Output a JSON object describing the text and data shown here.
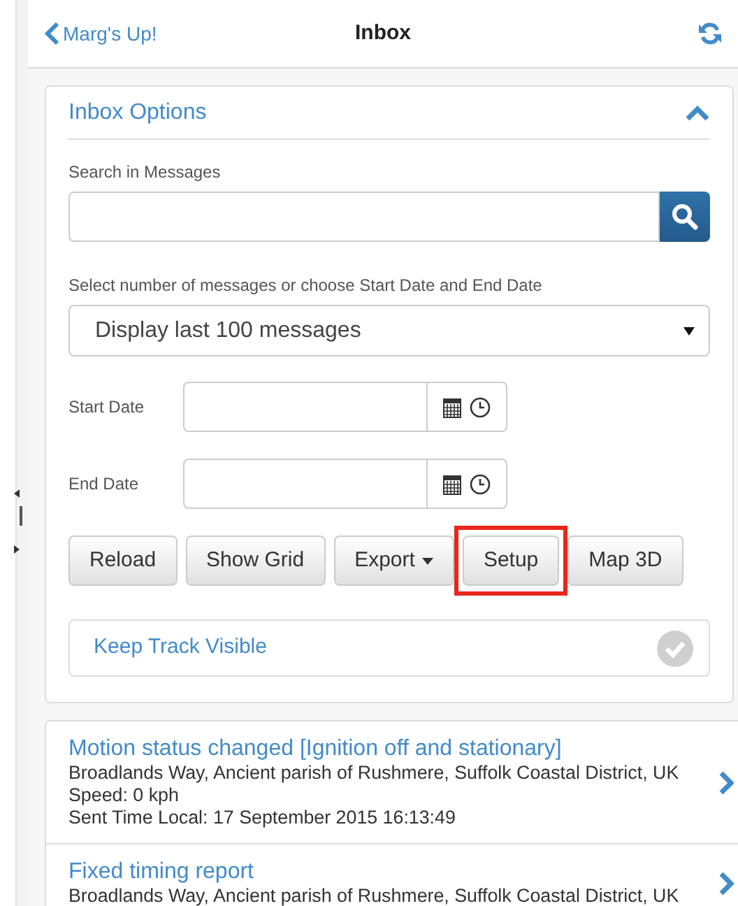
{
  "header": {
    "back_label": "Marg's Up!",
    "title": "Inbox"
  },
  "options_panel": {
    "title": "Inbox Options",
    "expanded": true,
    "search": {
      "label": "Search in Messages"
    },
    "range": {
      "label": "Select number of messages or choose Start Date and End Date",
      "value": "Display last 100 messages"
    },
    "dates": [
      {
        "label": "Start Date"
      },
      {
        "label": "End Date"
      }
    ],
    "buttons": [
      {
        "label": "Reload",
        "kind": "plain",
        "highlighted": false
      },
      {
        "label": "Show Grid",
        "kind": "plain",
        "highlighted": false
      },
      {
        "label": "Export",
        "kind": "dropdown",
        "highlighted": false
      },
      {
        "label": "Setup",
        "kind": "plain",
        "highlighted": true
      },
      {
        "label": "Map 3D",
        "kind": "plain",
        "highlighted": false
      }
    ],
    "keep_track": {
      "label": "Keep Track Visible",
      "checked": false
    }
  },
  "messages": [
    {
      "title": "Motion status changed [Ignition off and stationary]",
      "lines": [
        "Broadlands Way, Ancient parish of Rushmere, Suffolk Coastal District, UK",
        "Speed: 0 kph",
        "Sent Time Local: 17 September 2015 16:13:49"
      ]
    },
    {
      "title": "Fixed timing report",
      "lines": [
        "Broadlands Way, Ancient parish of Rushmere, Suffolk Coastal District, UK"
      ]
    }
  ]
}
